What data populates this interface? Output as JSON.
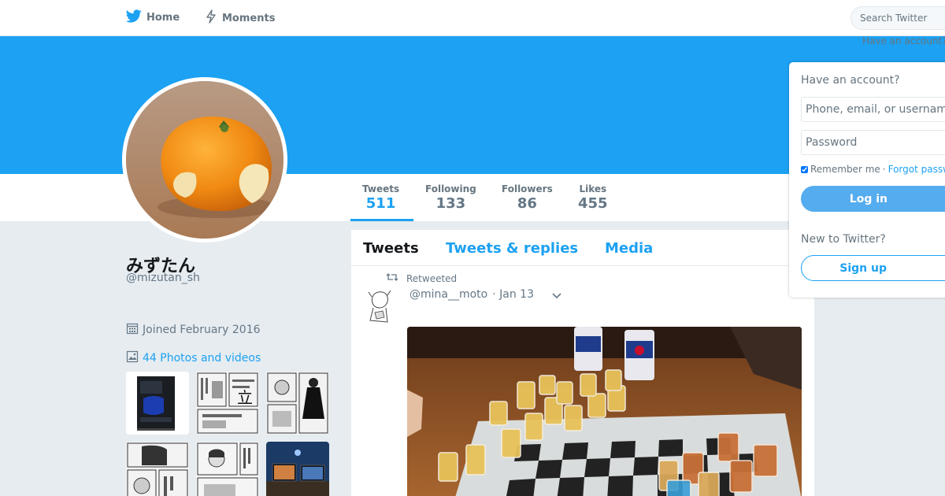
{
  "nav": {
    "home_label": "Home",
    "moments_label": "Moments",
    "search_placeholder": "Search Twitter"
  },
  "banner": {
    "have_account_hint": "Have an account?"
  },
  "profile": {
    "display_name": "みずたん",
    "handle": "@mizutan_sh",
    "joined": "Joined February 2016",
    "photos_link": "44 Photos and videos"
  },
  "stats": [
    {
      "label": "Tweets",
      "value": "511"
    },
    {
      "label": "Following",
      "value": "133"
    },
    {
      "label": "Followers",
      "value": "86"
    },
    {
      "label": "Likes",
      "value": "455"
    }
  ],
  "timeline": {
    "tabs": [
      "Tweets",
      "Tweets & replies",
      "Media"
    ],
    "tweet": {
      "retweet_label": "Retweeted",
      "author_handle": "@mina__moto",
      "date": "· Jan 13"
    }
  },
  "login": {
    "title": "Have an account?",
    "username_placeholder": "Phone, email, or username",
    "password_placeholder": "Password",
    "remember_label": "Remember me",
    "separator": "·",
    "forgot_label": "Forgot password?",
    "login_button": "Log in",
    "new_label": "New to Twitter?",
    "signup_button": "Sign up"
  },
  "colors": {
    "brand": "#1da1f2",
    "background": "#e6ecf0",
    "login_button": "#55acee"
  },
  "icons": [
    "twitter-bird-icon",
    "moments-lightning-icon",
    "calendar-icon",
    "photo-icon",
    "retweet-icon",
    "chevron-down-icon"
  ]
}
